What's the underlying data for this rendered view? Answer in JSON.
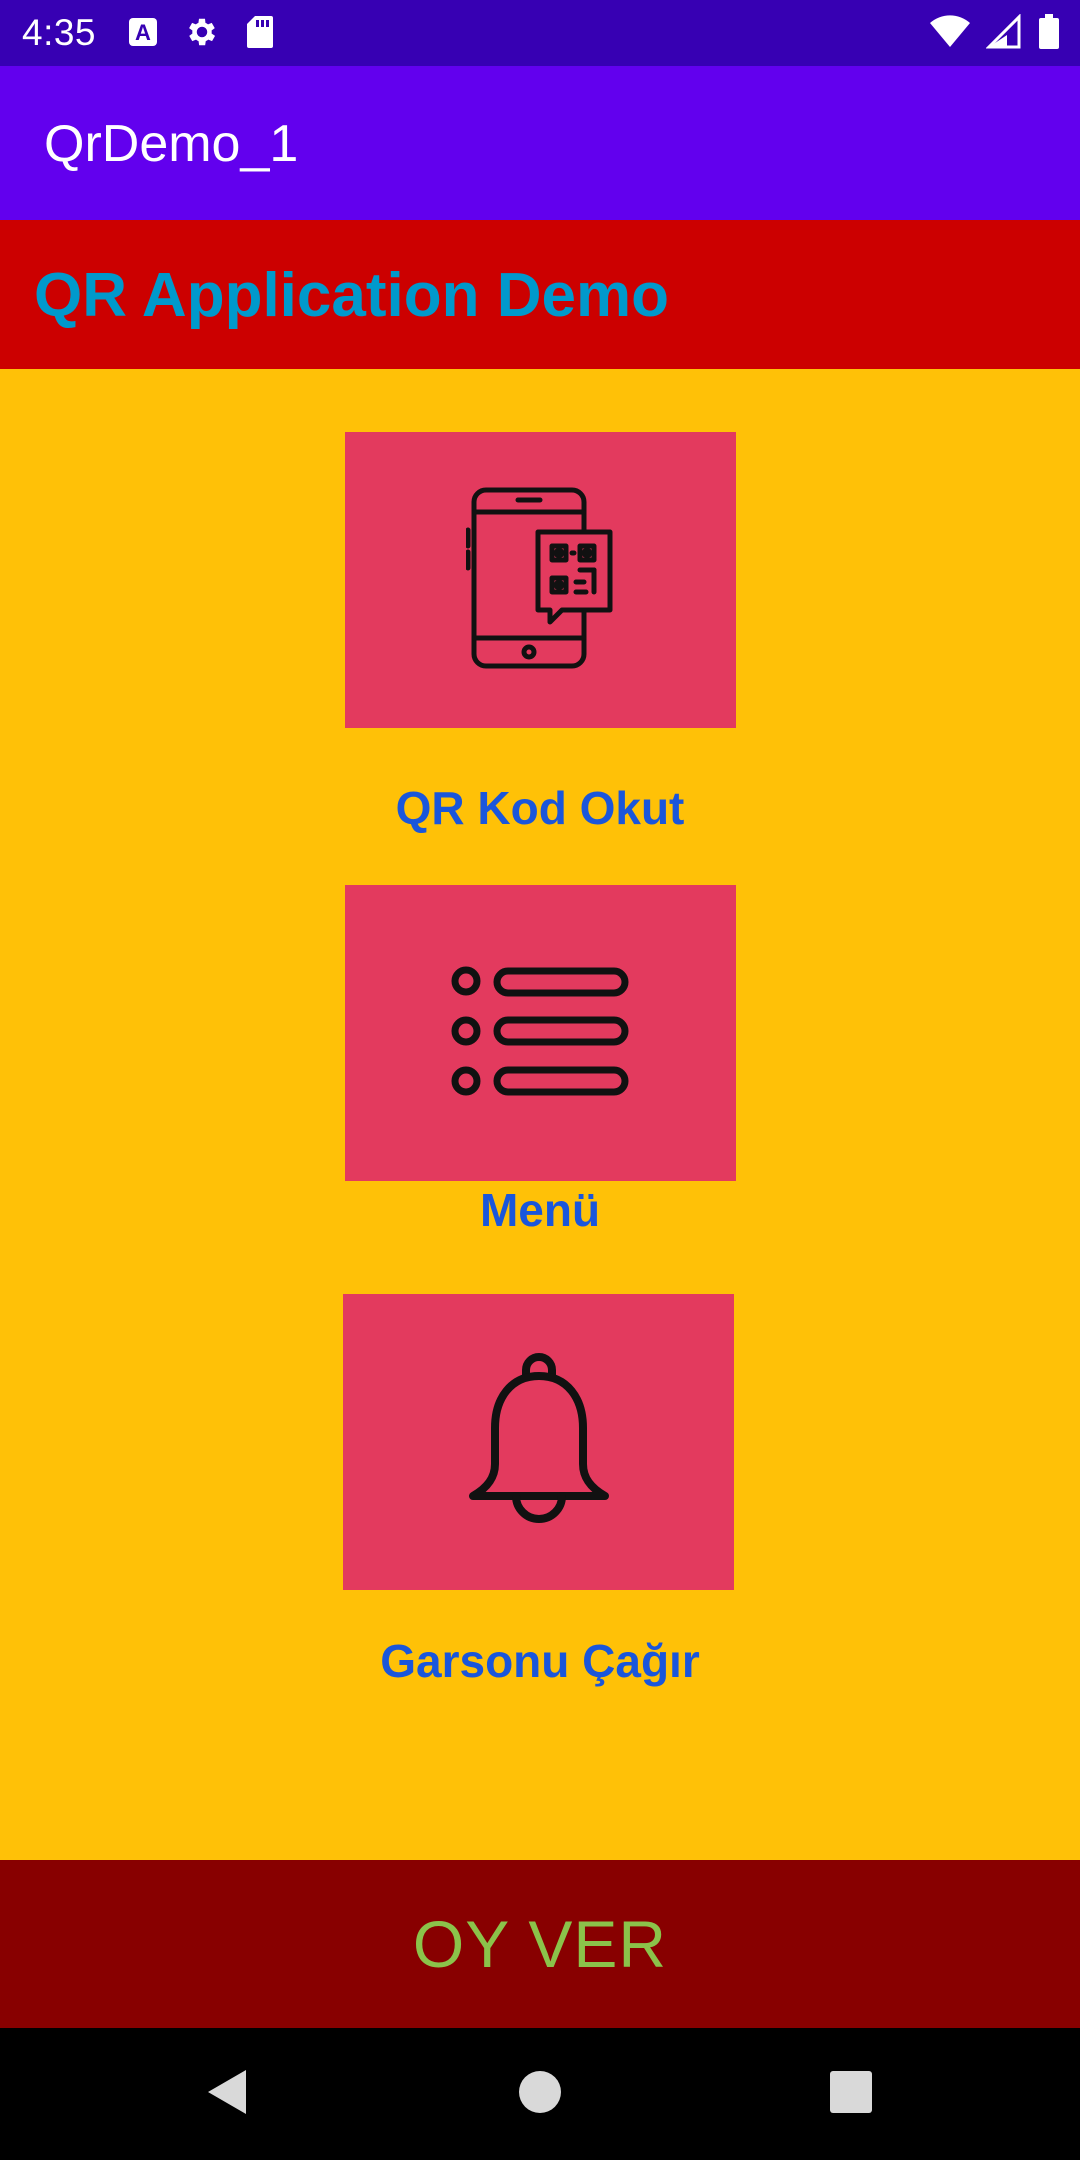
{
  "status_bar": {
    "time": "4:35",
    "left_icons": [
      "accessibility-a-icon",
      "gear-icon",
      "sd-card-icon"
    ],
    "right_icons": [
      "wifi-icon",
      "signal-icon",
      "battery-icon"
    ]
  },
  "app_bar": {
    "title": "QrDemo_1"
  },
  "header": {
    "text": "QR Application Demo"
  },
  "tiles": [
    {
      "icon": "phone-qr-icon",
      "label": "QR Kod Okut"
    },
    {
      "icon": "list-menu-icon",
      "label": "Menü"
    },
    {
      "icon": "bell-icon",
      "label": "Garsonu Çağır"
    }
  ],
  "vote_button": {
    "label": "OY VER"
  },
  "nav_bar": {
    "buttons": [
      "back-icon",
      "home-icon",
      "recents-icon"
    ]
  },
  "colors": {
    "status_bar": "#3700B3",
    "app_bar": "#6200EE",
    "header_bg": "#CC0000",
    "header_text": "#0099CC",
    "content_bg": "#FFC107",
    "tile_bg": "#E33A5E",
    "tile_label": "#1A56DB",
    "vote_bg": "#880000",
    "vote_text": "#8BC34A"
  }
}
